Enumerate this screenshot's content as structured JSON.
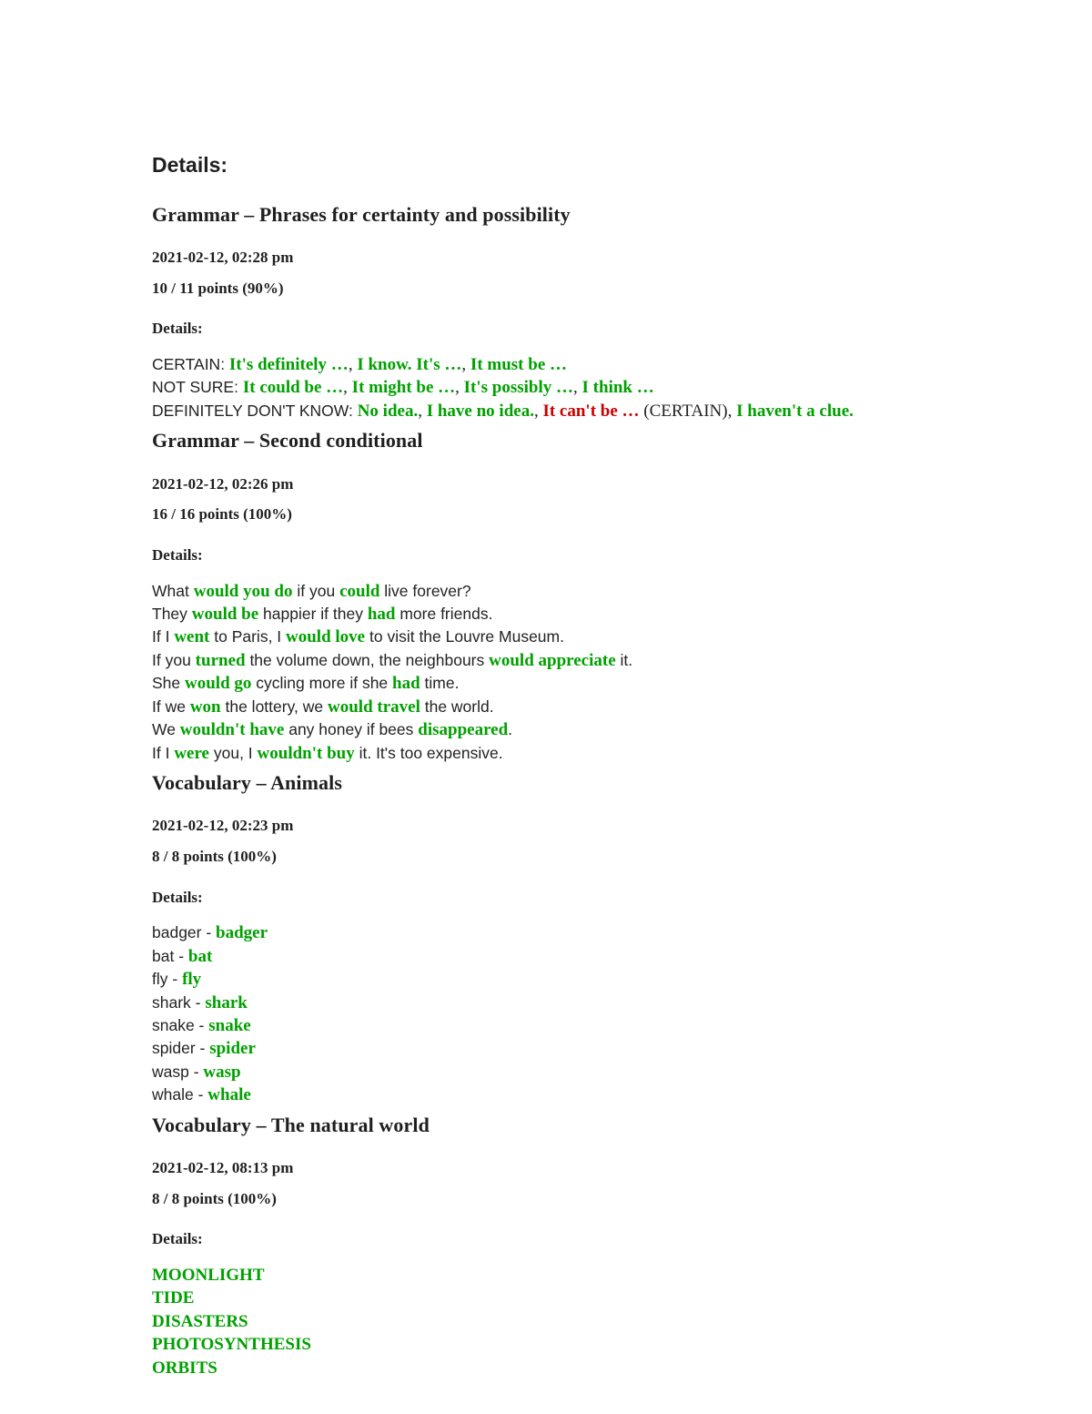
{
  "document": {
    "heading": "Details:"
  },
  "colors": {
    "answer_green": "#00a000",
    "answer_red": "#cc0000",
    "text": "#232323"
  },
  "labels": {
    "details": "Details:"
  },
  "sections": [
    {
      "title": "Grammar – Phrases for certainty and possibility",
      "timestamp": "2021-02-12, 02:28 pm",
      "points": "10 / 11 points (90%)",
      "details_label": "Details:",
      "lines": [
        {
          "parts": [
            {
              "text": "CERTAIN: ",
              "style": "plain"
            },
            {
              "text": "It's definitely …",
              "style": "green"
            },
            {
              "text": ", ",
              "style": "serif-plain"
            },
            {
              "text": "I know. It's …",
              "style": "green"
            },
            {
              "text": ", ",
              "style": "serif-plain"
            },
            {
              "text": "It must be …",
              "style": "green"
            }
          ]
        },
        {
          "parts": [
            {
              "text": "NOT SURE: ",
              "style": "plain"
            },
            {
              "text": "It could be …",
              "style": "green"
            },
            {
              "text": ", ",
              "style": "serif-plain"
            },
            {
              "text": "It might be …",
              "style": "green"
            },
            {
              "text": ", ",
              "style": "serif-plain"
            },
            {
              "text": "It's possibly …",
              "style": "green"
            },
            {
              "text": ", ",
              "style": "serif-plain"
            },
            {
              "text": "I think …",
              "style": "green"
            }
          ]
        },
        {
          "parts": [
            {
              "text": "DEFINITELY DON'T KNOW: ",
              "style": "plain"
            },
            {
              "text": "No idea.",
              "style": "green"
            },
            {
              "text": ", ",
              "style": "serif-plain"
            },
            {
              "text": "I have no idea.",
              "style": "green"
            },
            {
              "text": ", ",
              "style": "serif-plain"
            },
            {
              "text": "It can't be …",
              "style": "red"
            },
            {
              "text": " (CERTAIN), ",
              "style": "serif-plain"
            },
            {
              "text": "I haven't a clue.",
              "style": "green"
            }
          ]
        }
      ]
    },
    {
      "title": "Grammar – Second conditional",
      "timestamp": "2021-02-12, 02:26 pm",
      "points": "16 / 16 points (100%)",
      "details_label": "Details:",
      "lines": [
        {
          "parts": [
            {
              "text": "What ",
              "style": "plain"
            },
            {
              "text": "would you do",
              "style": "green"
            },
            {
              "text": " if you ",
              "style": "plain"
            },
            {
              "text": "could",
              "style": "green"
            },
            {
              "text": " live forever?",
              "style": "plain"
            }
          ]
        },
        {
          "parts": [
            {
              "text": "They ",
              "style": "plain"
            },
            {
              "text": "would be",
              "style": "green"
            },
            {
              "text": " happier if they ",
              "style": "plain"
            },
            {
              "text": "had",
              "style": "green"
            },
            {
              "text": " more friends.",
              "style": "plain"
            }
          ]
        },
        {
          "parts": [
            {
              "text": "If I ",
              "style": "plain"
            },
            {
              "text": "went",
              "style": "green"
            },
            {
              "text": " to Paris, I ",
              "style": "plain"
            },
            {
              "text": "would love",
              "style": "green"
            },
            {
              "text": " to visit the Louvre Museum.",
              "style": "plain"
            }
          ]
        },
        {
          "parts": [
            {
              "text": "If you ",
              "style": "plain"
            },
            {
              "text": "turned",
              "style": "green"
            },
            {
              "text": " the volume down, the neighbours ",
              "style": "plain"
            },
            {
              "text": "would appreciate",
              "style": "green"
            },
            {
              "text": " it.",
              "style": "plain"
            }
          ]
        },
        {
          "parts": [
            {
              "text": "She ",
              "style": "plain"
            },
            {
              "text": "would go",
              "style": "green"
            },
            {
              "text": " cycling more if she ",
              "style": "plain"
            },
            {
              "text": "had",
              "style": "green"
            },
            {
              "text": " time.",
              "style": "plain"
            }
          ]
        },
        {
          "parts": [
            {
              "text": "If we ",
              "style": "plain"
            },
            {
              "text": "won",
              "style": "green"
            },
            {
              "text": " the lottery, we ",
              "style": "plain"
            },
            {
              "text": "would travel",
              "style": "green"
            },
            {
              "text": " the world.",
              "style": "plain"
            }
          ]
        },
        {
          "parts": [
            {
              "text": "We ",
              "style": "plain"
            },
            {
              "text": "wouldn't have",
              "style": "green"
            },
            {
              "text": " any honey if bees ",
              "style": "plain"
            },
            {
              "text": "disappeared",
              "style": "green"
            },
            {
              "text": ".",
              "style": "plain"
            }
          ]
        },
        {
          "parts": [
            {
              "text": "If I ",
              "style": "plain"
            },
            {
              "text": "were",
              "style": "green"
            },
            {
              "text": " you, I ",
              "style": "plain"
            },
            {
              "text": "wouldn't buy",
              "style": "green"
            },
            {
              "text": " it. It's too expensive.",
              "style": "plain"
            }
          ]
        }
      ]
    },
    {
      "title": "Vocabulary – Animals",
      "timestamp": "2021-02-12, 02:23 pm",
      "points": "8 / 8 points (100%)",
      "details_label": "Details:",
      "lines": [
        {
          "parts": [
            {
              "text": "badger - ",
              "style": "plain"
            },
            {
              "text": "badger",
              "style": "green"
            }
          ]
        },
        {
          "parts": [
            {
              "text": "bat - ",
              "style": "plain"
            },
            {
              "text": "bat",
              "style": "green"
            }
          ]
        },
        {
          "parts": [
            {
              "text": "fly - ",
              "style": "plain"
            },
            {
              "text": "fly",
              "style": "green"
            }
          ]
        },
        {
          "parts": [
            {
              "text": "shark - ",
              "style": "plain"
            },
            {
              "text": "shark",
              "style": "green"
            }
          ]
        },
        {
          "parts": [
            {
              "text": "snake - ",
              "style": "plain"
            },
            {
              "text": "snake",
              "style": "green"
            }
          ]
        },
        {
          "parts": [
            {
              "text": "spider - ",
              "style": "plain"
            },
            {
              "text": "spider",
              "style": "green"
            }
          ]
        },
        {
          "parts": [
            {
              "text": "wasp - ",
              "style": "plain"
            },
            {
              "text": "wasp",
              "style": "green"
            }
          ]
        },
        {
          "parts": [
            {
              "text": "whale - ",
              "style": "plain"
            },
            {
              "text": "whale",
              "style": "green"
            }
          ]
        }
      ]
    },
    {
      "title": "Vocabulary – The natural world",
      "timestamp": "2021-02-12, 08:13 pm",
      "points": "8 / 8 points (100%)",
      "details_label": "Details:",
      "lines": [
        {
          "parts": [
            {
              "text": "MOONLIGHT",
              "style": "green"
            }
          ]
        },
        {
          "parts": [
            {
              "text": "TIDE",
              "style": "green"
            }
          ]
        },
        {
          "parts": [
            {
              "text": "DISASTERS",
              "style": "green"
            }
          ]
        },
        {
          "parts": [
            {
              "text": "PHOTOSYNTHESIS",
              "style": "green"
            }
          ]
        },
        {
          "parts": [
            {
              "text": "ORBITS",
              "style": "green"
            }
          ]
        }
      ]
    }
  ]
}
